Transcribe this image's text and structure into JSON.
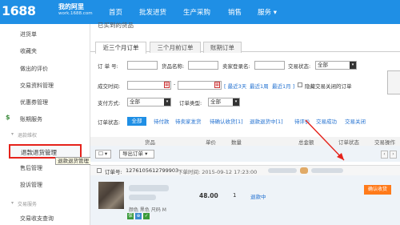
{
  "topnav": {
    "logo": "1688",
    "brand_title": "我的阿里",
    "brand_sub": "work.1688.com",
    "items": [
      "首页",
      "批发进货",
      "生产采购",
      "销售",
      "服务 ▾"
    ]
  },
  "sidebar": {
    "items": {
      "i1": "进货单",
      "i2": "收藏夹",
      "i3": "做出的评价",
      "i4": "交易资料管理",
      "i5": "优惠券管理",
      "i6": "账期服务",
      "sec1": "退款维权",
      "active": "退款退货管理",
      "tooltip": "退款退货管理",
      "i8": "售后管理",
      "i9": "投诉管理",
      "sec2": "交易服务",
      "i10": "交易收支查询"
    }
  },
  "main": {
    "title": "已买到的货品",
    "tabs": [
      "近三个月订单",
      "三个月前订单",
      "账期订单"
    ],
    "filters": {
      "order_no": "订 单 号:",
      "goods_name": "货品名称:",
      "seller": "卖家登录名:",
      "trade_status": "交易状态:",
      "trade_status_value": "全部",
      "deal_time": "成交时间:",
      "recent3": "[ 最近3天",
      "recent1w": "最近1周",
      "recent1m": "最近1月 ]",
      "hide_closed": "隐藏交易关闭的订单",
      "pay_method": "支付方式:",
      "pay_method_value": "全部",
      "order_type": "订单类型:",
      "order_type_value": "全部"
    },
    "status_bar": {
      "label": "订单状态:",
      "all": "全部",
      "items": [
        "待付款",
        "待卖家发货",
        "待确认收货[1]",
        "退款退货中[1]",
        "待评价",
        "交易成功",
        "交易关闭"
      ]
    },
    "table_head": [
      "货品",
      "单价",
      "数量",
      "总金额",
      "订单状态",
      "交易操作"
    ],
    "toolbar": {
      "export": "导出订单 ▾"
    },
    "order": {
      "label": "订单号:",
      "number": "1276105612799903",
      "time": "下单时间: 2015-09-12 17:23:00",
      "price": "48.00",
      "qty": "1",
      "status": "退款中",
      "color_line": "颜色  黑色  尺码 M",
      "action": "确认收货"
    }
  },
  "colors": {
    "brand_blue": "#1f8fe5",
    "highlight_red": "#e5221b",
    "orange_action": "#ff7a1a"
  }
}
